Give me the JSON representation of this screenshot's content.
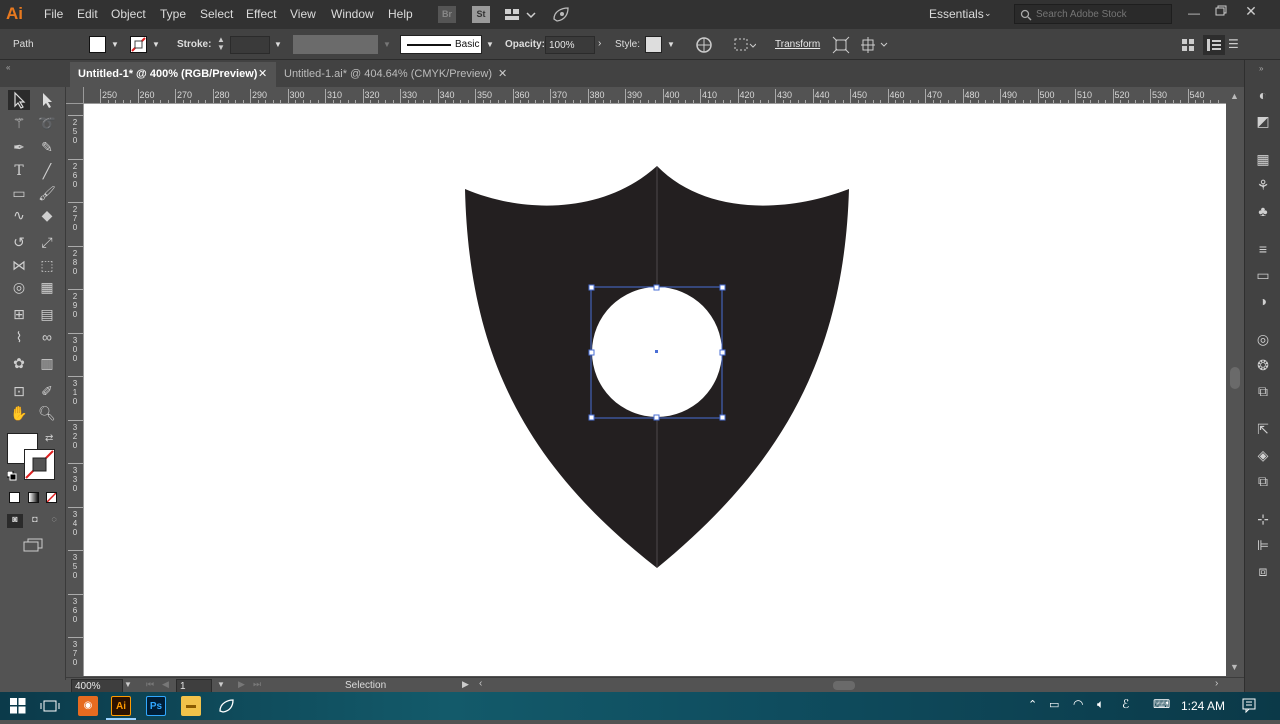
{
  "app": {
    "logo": "Ai",
    "menus": [
      "File",
      "Edit",
      "Object",
      "Type",
      "Select",
      "Effect",
      "View",
      "Window",
      "Help"
    ],
    "bridge_label": "Br",
    "stock_label": "St",
    "workspace": "Essentials",
    "search_placeholder": "Search Adobe Stock"
  },
  "control_bar": {
    "selection_type": "Path",
    "stroke_label": "Stroke:",
    "stroke_value": "",
    "brush_label": "Basic",
    "opacity_label": "Opacity:",
    "opacity_value": "100%",
    "style_label": "Style:",
    "transform_label": "Transform"
  },
  "tabs": [
    {
      "label": "Untitled-1* @ 400% (RGB/Preview)",
      "active": true
    },
    {
      "label": "Untitled-1.ai* @ 404.64% (CMYK/Preview)",
      "active": false
    }
  ],
  "ruler_top": [
    "250",
    "260",
    "270",
    "280",
    "290",
    "300",
    "310",
    "320",
    "330",
    "340",
    "350",
    "360",
    "370",
    "380",
    "390",
    "400",
    "410",
    "420",
    "430",
    "440",
    "450",
    "460",
    "470",
    "480",
    "490",
    "500",
    "510",
    "520",
    "530",
    "540"
  ],
  "ruler_left": [
    [
      "2",
      "5",
      "0"
    ],
    [
      "2",
      "6",
      "0"
    ],
    [
      "2",
      "7",
      "0"
    ],
    [
      "2",
      "8",
      "0"
    ],
    [
      "2",
      "9",
      "0"
    ],
    [
      "3",
      "0",
      "0"
    ],
    [
      "3",
      "1",
      "0"
    ],
    [
      "3",
      "2",
      "0"
    ],
    [
      "3",
      "3",
      "0"
    ],
    [
      "3",
      "4",
      "0"
    ],
    [
      "3",
      "5",
      "0"
    ],
    [
      "3",
      "6",
      "0"
    ],
    [
      "3",
      "7",
      "0"
    ]
  ],
  "status": {
    "zoom": "400%",
    "artboard": "1",
    "tool": "Selection"
  },
  "taskbar": {
    "time": "1:24 AM",
    "apps": [
      "Ai",
      "Ps"
    ]
  },
  "colors": {
    "shield": "#231f20",
    "accent": "#e8791f",
    "selection": "#4a6fd6"
  }
}
